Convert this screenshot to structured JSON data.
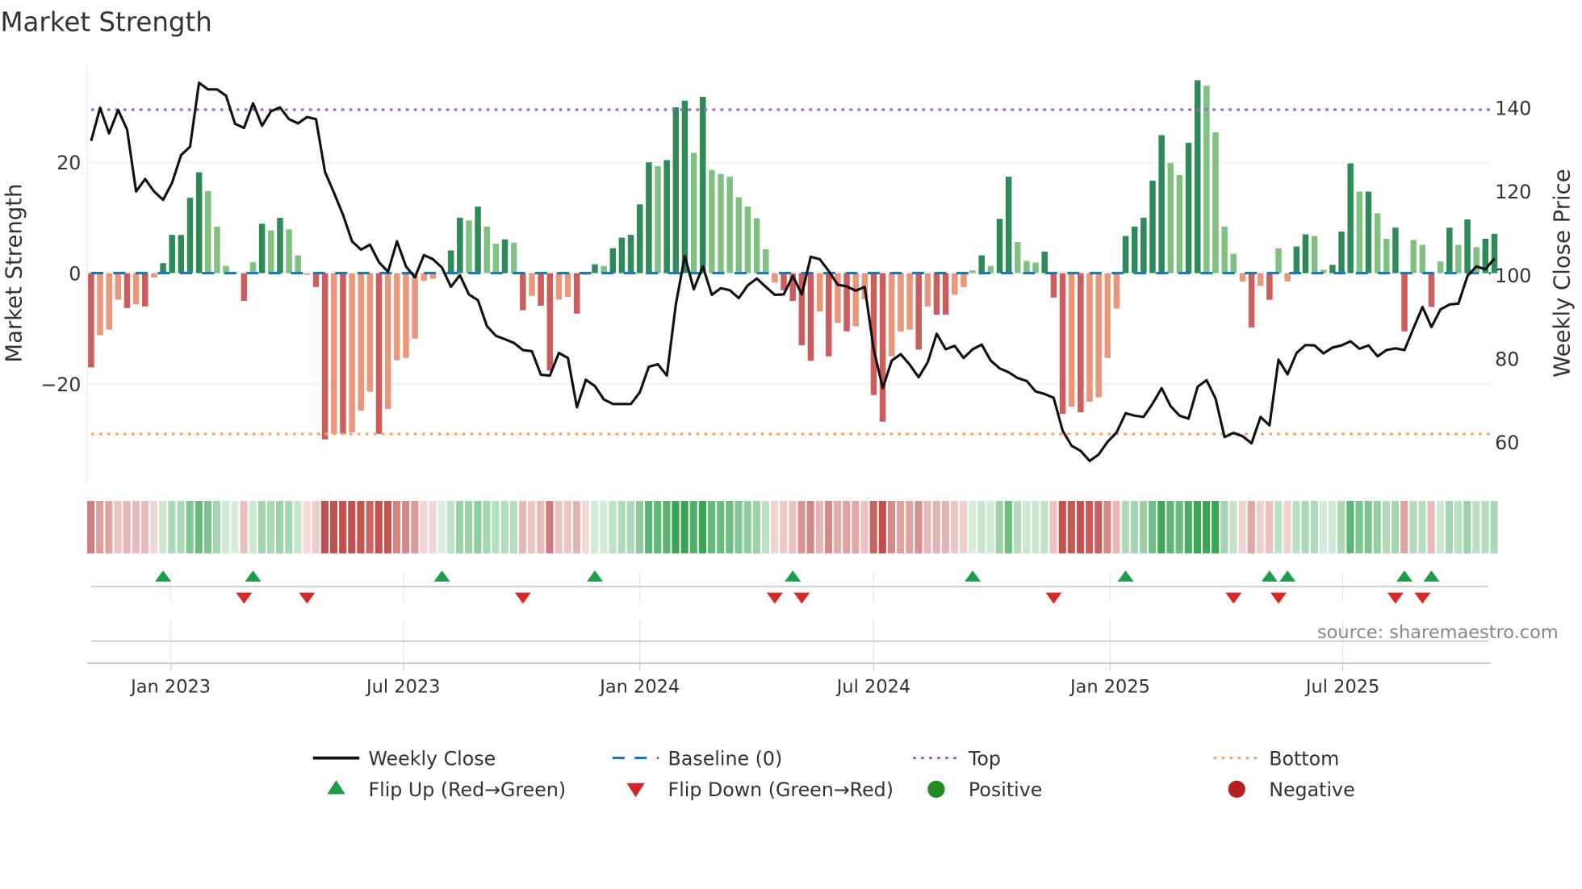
{
  "chart_data": {
    "type": "bar",
    "title": "Market Strength",
    "ylabel": "Market Strength",
    "y2label": "Weekly Close Price",
    "ylim": [
      -38,
      38
    ],
    "y2lim": [
      52,
      152
    ],
    "yticks": [
      "20",
      "0",
      "−20"
    ],
    "ytick_values": [
      20,
      0,
      -20
    ],
    "y2ticks": [
      "140",
      "120",
      "100",
      "80",
      "60"
    ],
    "y2tick_values": [
      140,
      120,
      100,
      80,
      60
    ],
    "start_week": "2022-10-31",
    "xticks": [
      {
        "label": "Jan 2023",
        "date": "2023-01-01"
      },
      {
        "label": "Jul 2023",
        "date": "2023-07-01"
      },
      {
        "label": "Jan 2024",
        "date": "2024-01-01"
      },
      {
        "label": "Jul 2024",
        "date": "2024-07-01"
      },
      {
        "label": "Jan 2025",
        "date": "2025-01-01"
      },
      {
        "label": "Jul 2025",
        "date": "2025-07-01"
      }
    ],
    "top_level": 29.5,
    "bottom_level": -29,
    "baseline": 0,
    "strength": [
      -17,
      -11.2,
      -10.2,
      -4.8,
      -6.3,
      -5.6,
      -6,
      -0.8,
      1.8,
      6.9,
      6.9,
      13.6,
      18.2,
      14.8,
      8.4,
      1.3,
      0,
      -5,
      2,
      8.9,
      7.7,
      10,
      7.9,
      3.2,
      -0.3,
      -2.5,
      -30,
      -29,
      -29,
      -28.7,
      -24.8,
      -21.4,
      -29,
      -24.5,
      -15.7,
      -15.3,
      -11.8,
      -1.4,
      -1,
      0,
      4.1,
      10,
      9.5,
      12,
      8.4,
      5.3,
      6.1,
      5.5,
      -6.7,
      -4.1,
      -5.9,
      -17.6,
      -4.8,
      -4.3,
      -7.3,
      -0.3,
      1.6,
      1.3,
      4.5,
      6.4,
      6.9,
      12.4,
      20,
      19.3,
      20.4,
      29.9,
      31.1,
      21.7,
      31.8,
      18.6,
      17.9,
      17.4,
      13.7,
      12,
      9.9,
      4.3,
      -1.7,
      -3.1,
      -5,
      -13,
      -15.8,
      -6.9,
      -15,
      -9,
      -10.5,
      -9.6,
      -4.7,
      -22,
      -26.8,
      -15,
      -10.5,
      -10.2,
      -13.8,
      -6,
      -7.5,
      -7.5,
      -3.9,
      -2.5,
      0.5,
      3.2,
      1.3,
      9.8,
      17.4,
      5.6,
      2.2,
      1.9,
      3.9,
      -4.4,
      -25.4,
      -24.1,
      -25.1,
      -23.2,
      -22.4,
      -15.3,
      -6.4,
      6.7,
      8.4,
      10,
      16.7,
      24.9,
      19.9,
      17.7,
      23.5,
      34.8,
      33.8,
      25.4,
      8.4,
      3.5,
      -1.5,
      -9.8,
      -2.3,
      -4.8,
      4.5,
      -1.5,
      4.8,
      7,
      6.7,
      0.6,
      1.5,
      7.5,
      19.8,
      14.7,
      14.7,
      10.8,
      6.2,
      8.2,
      -10.5,
      6,
      5.1,
      -6.1,
      2.1,
      8.2,
      5.1,
      9.7,
      4.7,
      6.2,
      7.1
    ],
    "weekly_close": [
      132.1,
      140,
      133.9,
      139.5,
      134.8,
      120,
      123,
      120,
      118,
      122.1,
      128.7,
      130.7,
      146,
      144.4,
      144.4,
      142.9,
      136.2,
      135.2,
      141.1,
      135.7,
      139.2,
      140.1,
      137.3,
      136.3,
      137.8,
      137.3,
      124.7,
      119.7,
      114.4,
      108.1,
      106.1,
      107.3,
      103.1,
      100.8,
      108.1,
      102.1,
      99.5,
      104.8,
      103.8,
      101.8,
      97.2,
      100,
      95.4,
      94,
      87.8,
      85.5,
      84.7,
      83.8,
      82.1,
      81.8,
      76.2,
      76,
      81.4,
      80.2,
      68.4,
      75,
      73.5,
      70.3,
      69.2,
      69.2,
      69.2,
      72,
      78.1,
      78.7,
      76,
      93,
      104.6,
      96.6,
      102.1,
      95.3,
      96.9,
      96.4,
      94.5,
      97.6,
      99.2,
      97.2,
      95.3,
      95.4,
      99.8,
      95.4,
      104.4,
      103.8,
      101,
      97.7,
      97.3,
      96.3,
      97.2,
      82.3,
      73,
      79.6,
      81.1,
      78.6,
      75.6,
      79.2,
      86,
      82.3,
      83.1,
      80.2,
      82.3,
      83.4,
      79.6,
      77.7,
      76.8,
      75.4,
      74.7,
      72.2,
      71.6,
      70.7,
      62.8,
      59.2,
      58,
      55.6,
      57.1,
      60.2,
      62.4,
      67,
      66.4,
      66.1,
      69.3,
      73,
      68.7,
      66.4,
      65.7,
      73.3,
      74.9,
      70.5,
      61.3,
      62.3,
      61.5,
      59.8,
      66.1,
      64.1,
      79.8,
      76.3,
      81.4,
      83.3,
      83.2,
      81.3,
      82.7,
      83.2,
      84.2,
      82.4,
      83.2,
      80.6,
      82.1,
      82.5,
      82.1,
      87.3,
      92.4,
      87.6,
      91.8,
      93,
      93.2,
      99.8,
      102.1,
      101.4,
      104
    ],
    "flip_up_weeks": [
      9,
      19,
      40,
      57,
      79,
      99,
      116,
      132,
      134,
      147,
      150
    ],
    "flip_down_weeks": [
      18,
      25,
      49,
      77,
      80,
      108,
      128,
      133,
      146,
      149
    ],
    "legend": [
      {
        "label": "Weekly Close",
        "symbol": "line"
      },
      {
        "label": "Baseline (0)",
        "symbol": "dash"
      },
      {
        "label": "Top",
        "symbol": "dot"
      },
      {
        "label": "Bottom",
        "symbol": "dot"
      },
      {
        "label": "Flip Up (Red→Green)",
        "symbol": "triangle-up"
      },
      {
        "label": "Flip Down (Green→Red)",
        "symbol": "triangle-down"
      },
      {
        "label": "Positive",
        "symbol": "circle"
      },
      {
        "label": "Negative",
        "symbol": "circle"
      }
    ],
    "legend_placement": "bottom",
    "source": "source: sharemaestro.com"
  },
  "colors": {
    "pos_strong": "#2e8b57",
    "pos_weak": "#80c080",
    "neg_strong": "#cd5c5c",
    "neg_weak": "#e9967a",
    "line": "#111111",
    "baseline": "#1f77b4",
    "top": "#9966cc",
    "bottom": "#f4a460",
    "flip_up": "#1a9e4a",
    "flip_down": "#d62728",
    "positive": "#228b22",
    "negative": "#b22222"
  }
}
